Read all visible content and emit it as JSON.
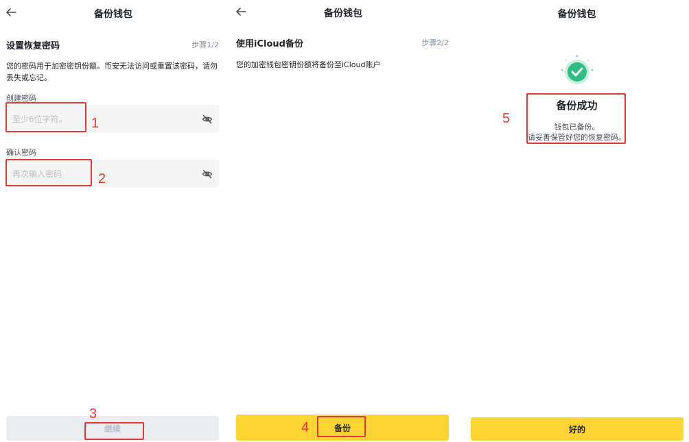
{
  "screen1": {
    "title": "备份钱包",
    "section_title": "设置恢复密码",
    "step": "步骤1/2",
    "description": "您的密码用于加密密钥份额。币安无法访问或重置该密码，请勿丢失或忘记。",
    "create_label": "创建密码",
    "create_placeholder": "至少6位字符。",
    "confirm_label": "确认密码",
    "confirm_placeholder": "再次输入密码",
    "continue_label": "继续"
  },
  "screen2": {
    "title": "备份钱包",
    "section_title": "使用iCloud备份",
    "step": "步骤2/2",
    "description": "您的加密钱包密钥份额将备份至iCloud账户",
    "backup_label": "备份"
  },
  "screen3": {
    "title": "备份钱包",
    "success_title": "备份成功",
    "success_line1": "钱包已备份。",
    "success_line2": "请妥善保管好您的恢复密码。",
    "ok_label": "好的"
  },
  "annotations": {
    "n1": "1",
    "n2": "2",
    "n3": "3",
    "n4": "4",
    "n5": "5"
  },
  "colors": {
    "accent_yellow": "#fcd535",
    "success_green": "#2ebd85",
    "annotation_red": "#e53935"
  },
  "icons": [
    "back-arrow-icon",
    "eye-off-icon",
    "check-circle-icon"
  ]
}
